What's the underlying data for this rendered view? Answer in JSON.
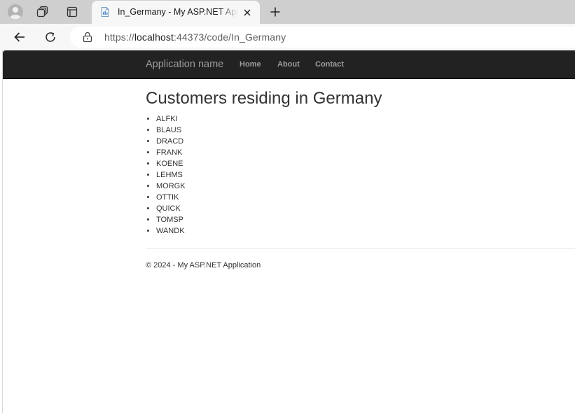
{
  "browser": {
    "tab": {
      "title": "In_Germany - My ASP.NET Application",
      "favicon": "page-icon",
      "close_icon": "close-icon"
    },
    "buttons": {
      "profile": "profile-icon",
      "workspaces": "workspaces-icon",
      "tab_actions": "tab-actions-icon",
      "new_tab": "plus-icon",
      "back": "back-arrow-icon",
      "reload": "reload-icon"
    },
    "address": {
      "scheme": "https://",
      "host": "localhost",
      "rest": ":44373/code/In_Germany",
      "lock_icon": "lock-icon"
    },
    "colors": {
      "tabbar": "#cfcfcf",
      "toolbar": "#f7f7f7"
    }
  },
  "site": {
    "brand": "Application name",
    "nav": [
      {
        "label": "Home"
      },
      {
        "label": "About"
      },
      {
        "label": "Contact"
      }
    ],
    "colors": {
      "navbar": "#222222",
      "nav_text": "#9d9d9d",
      "body_text": "#333333"
    }
  },
  "main": {
    "heading": "Customers residing in Germany",
    "customers": [
      "ALFKI",
      "BLAUS",
      "DRACD",
      "FRANK",
      "KOENE",
      "LEHMS",
      "MORGK",
      "OTTIK",
      "QUICK",
      "TOMSP",
      "WANDK"
    ]
  },
  "footer": {
    "text": "© 2024 - My ASP.NET Application"
  }
}
